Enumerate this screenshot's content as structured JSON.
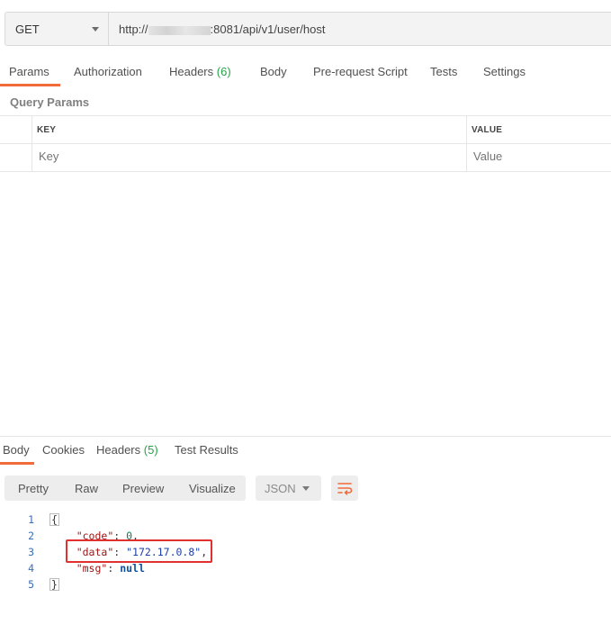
{
  "request": {
    "method": "GET",
    "url_prefix": "http://",
    "url_suffix": ":8081/api/v1/user/host"
  },
  "request_tabs": [
    {
      "label": "Params",
      "count": ""
    },
    {
      "label": "Authorization",
      "count": ""
    },
    {
      "label": "Headers",
      "count": "(6)"
    },
    {
      "label": "Body",
      "count": ""
    },
    {
      "label": "Pre-request Script",
      "count": ""
    },
    {
      "label": "Tests",
      "count": ""
    },
    {
      "label": "Settings",
      "count": ""
    }
  ],
  "query_params": {
    "title": "Query Params",
    "col_key": "KEY",
    "col_value": "VALUE",
    "key_placeholder": "Key",
    "value_placeholder": "Value"
  },
  "response_tabs": [
    {
      "label": "Body",
      "count": ""
    },
    {
      "label": "Cookies",
      "count": ""
    },
    {
      "label": "Headers",
      "count": "(5)"
    },
    {
      "label": "Test Results",
      "count": ""
    }
  ],
  "format_buttons": [
    "Pretty",
    "Raw",
    "Preview",
    "Visualize"
  ],
  "language": "JSON",
  "accent_color": "#f26b3a",
  "count_color": "#26a34a",
  "code": {
    "line_numbers": [
      "1",
      "2",
      "3",
      "4",
      "5"
    ],
    "open_brace": "{",
    "close_brace": "}",
    "k_code": "\"code\"",
    "v_code": "0",
    "k_data": "\"data\"",
    "v_data": "\"172.17.0.8\"",
    "k_msg": "\"msg\"",
    "v_msg": "null"
  }
}
